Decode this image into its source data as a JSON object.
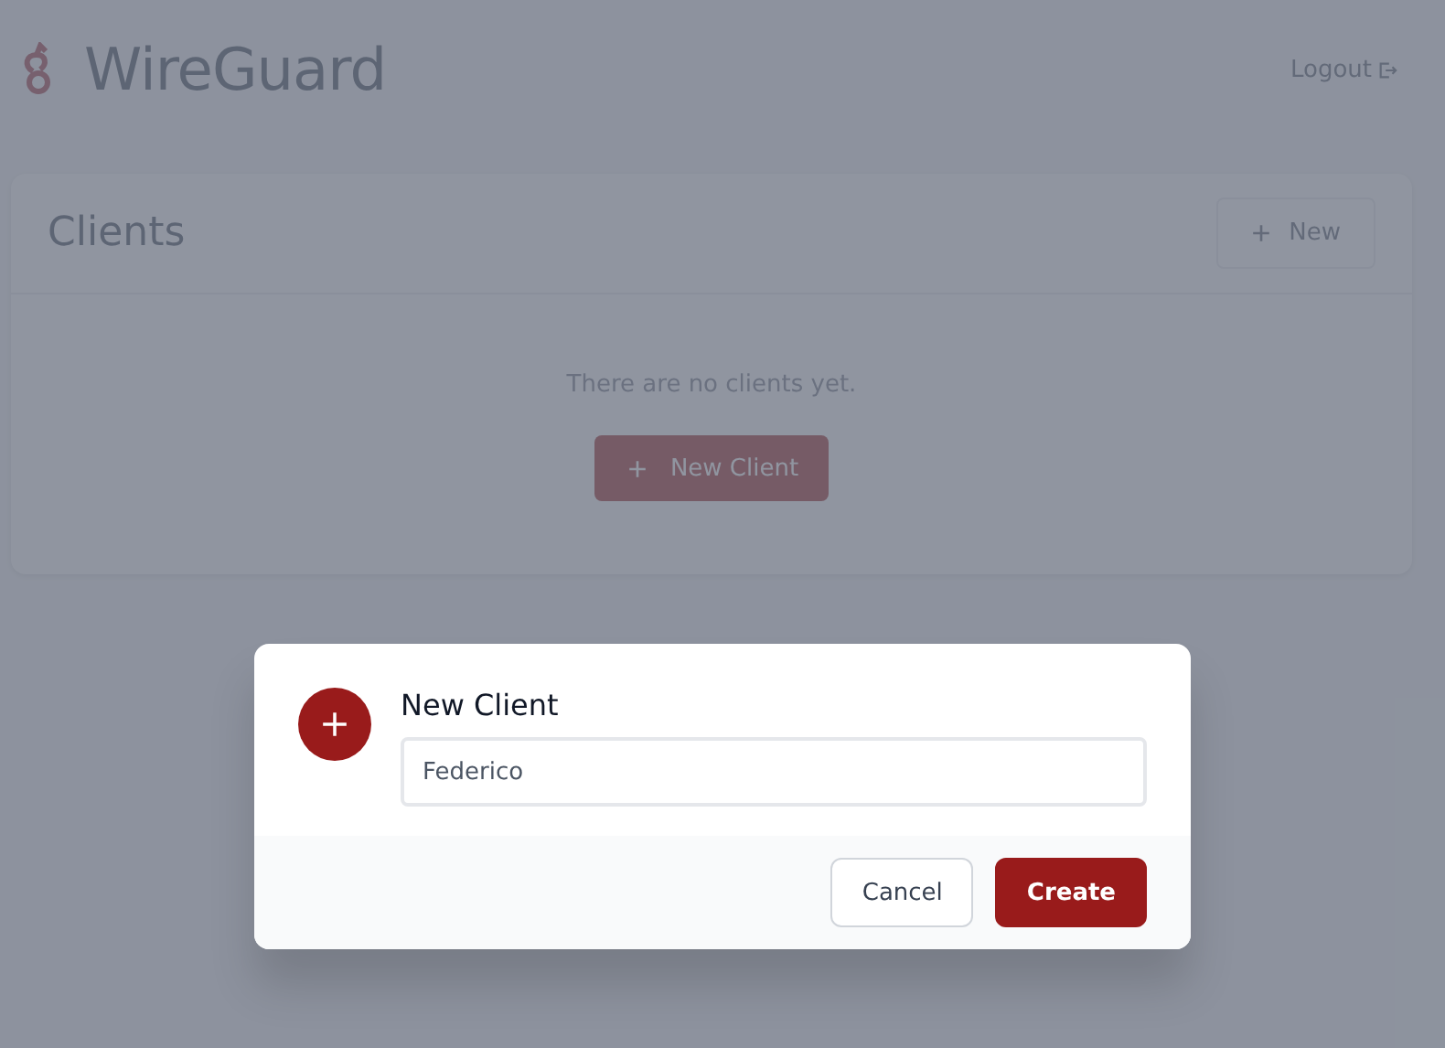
{
  "header": {
    "title": "WireGuard",
    "logout": "Logout"
  },
  "clients": {
    "title": "Clients",
    "new_button": "New",
    "empty_text": "There are no clients yet.",
    "new_client_button": "New Client"
  },
  "dialog": {
    "open": true,
    "title": "New Client",
    "name_value": "Federico",
    "buttons": [
      {
        "label": "Cancel",
        "kind": "secondary"
      },
      {
        "label": "Create",
        "kind": "primary"
      }
    ]
  }
}
